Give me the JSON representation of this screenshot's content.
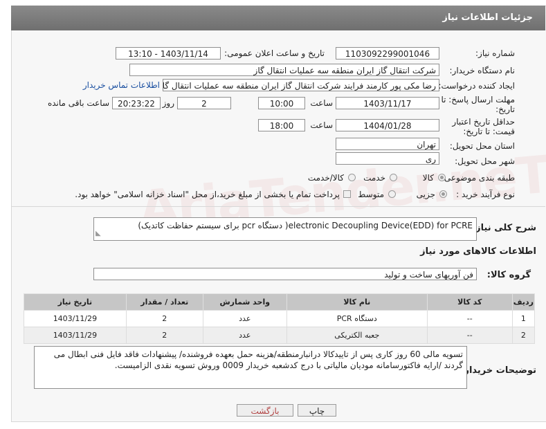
{
  "page": {
    "title": "جزئیات اطلاعات نیاز"
  },
  "watermark": "AriaTender.neT",
  "fields": {
    "need_number_label": "شماره نیاز:",
    "need_number": "1103092299001046",
    "announce_label": "تاریخ و ساعت اعلان عمومی:",
    "announce_value": "1403/11/14 - 13:10",
    "buyer_label": "نام دستگاه خریدار:",
    "buyer_value": "شرکت انتقال گاز ایران منطقه سه عملیات انتقال گاز",
    "creator_label": "ایجاد کننده درخواست:",
    "creator_value": "رضا مکی پور کارمند فرایند شرکت انتقال گاز ایران منطقه سه عملیات انتقال گاز",
    "contact_link": "اطلاعات تماس خریدار",
    "deadline_label": "مهلت ارسال پاسخ: تا تاریخ:",
    "deadline_date": "1403/11/17",
    "time_label": "ساعت",
    "deadline_time": "10:00",
    "days_value": "2",
    "days_label": "روز و",
    "remaining_time": "20:23:22",
    "remaining_label": "ساعت باقی مانده",
    "validity_label": "حداقل تاریخ اعتبار قیمت: تا تاریخ:",
    "validity_date": "1404/01/28",
    "validity_time": "18:00",
    "province_label": "استان محل تحویل:",
    "province_value": "تهران",
    "city_label": "شهر محل تحویل:",
    "city_value": "ری",
    "category_label": "طبقه بندی موضوعی:",
    "category_options": [
      "کالا",
      "خدمت",
      "کالا/خدمت"
    ],
    "process_label": "نوع فرآیند خرید :",
    "process_options": [
      "جزیی",
      "متوسط"
    ],
    "payment_text": "پرداخت تمام یا بخشی از مبلغ خرید،از محل \"اسناد خزانه اسلامی\" خواهد بود."
  },
  "description": {
    "label": "شرح کلی نیاز:",
    "value": "electronic Decoupling Device(EDD) for PCRE( دستگاه pcr برای سیستم حفاظت کاتدیک)"
  },
  "goods": {
    "section_title": "اطلاعات کالاهای مورد نیاز",
    "group_label": "گروه کالا:",
    "group_value": "فن آوریهای ساخت و تولید",
    "columns": [
      "ردیف",
      "کد کالا",
      "نام کالا",
      "واحد شمارش",
      "تعداد / مقدار",
      "تاریخ نیاز"
    ],
    "rows": [
      [
        "1",
        "--",
        "دستگاه PCR",
        "عدد",
        "2",
        "1403/11/29"
      ],
      [
        "2",
        "--",
        "جعبه الکتریکی",
        "عدد",
        "2",
        "1403/11/29"
      ]
    ]
  },
  "buyer_notes": {
    "label": "توضیحات خریدار:",
    "value": "تسویه مالی 60 روز کاری پس از تاییدکالا درانبارمنطقه/هزینه حمل بعهده فروشنده/ پیشنهادات فاقد فایل فنی ابطال می گردند /ارایه فاکتورسامانه مودیان مالیاتی با درج کدشعبه خریدار 0009 وروش تسویه نقدی الزامیست."
  },
  "buttons": {
    "print": "چاپ",
    "back": "بازگشت"
  }
}
